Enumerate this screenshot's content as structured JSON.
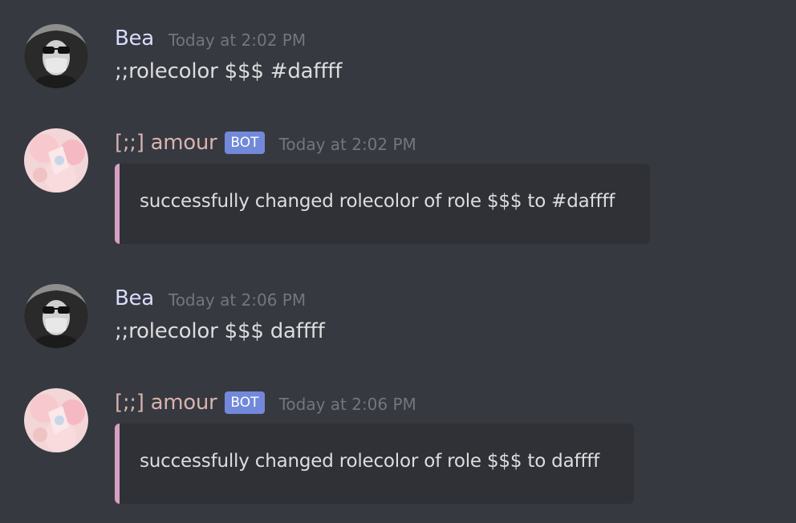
{
  "colors": {
    "background": "#36393f",
    "user_name": "#dadcff",
    "bot_name": "#d7b3b0",
    "bot_tag": "#7289da",
    "embed_accent": "#d6a0c4",
    "embed_bg": "#2f3136"
  },
  "messages": [
    {
      "author": "Bea",
      "timestamp": "Today at 2:02 PM",
      "text": ";;rolecolor $$$ #daffff",
      "avatar_icon": "user-avatar-icon"
    },
    {
      "author": "[;;] amour",
      "tag": "BOT",
      "timestamp": "Today at 2:02 PM",
      "embed_text": "successfully changed rolecolor of role $$$ to #daffff",
      "avatar_icon": "bot-avatar-icon"
    },
    {
      "author": "Bea",
      "timestamp": "Today at 2:06 PM",
      "text": ";;rolecolor $$$ daffff",
      "avatar_icon": "user-avatar-icon"
    },
    {
      "author": "[;;] amour",
      "tag": "BOT",
      "timestamp": "Today at 2:06 PM",
      "embed_text": "successfully changed rolecolor of role $$$ to daffff",
      "avatar_icon": "bot-avatar-icon"
    }
  ]
}
